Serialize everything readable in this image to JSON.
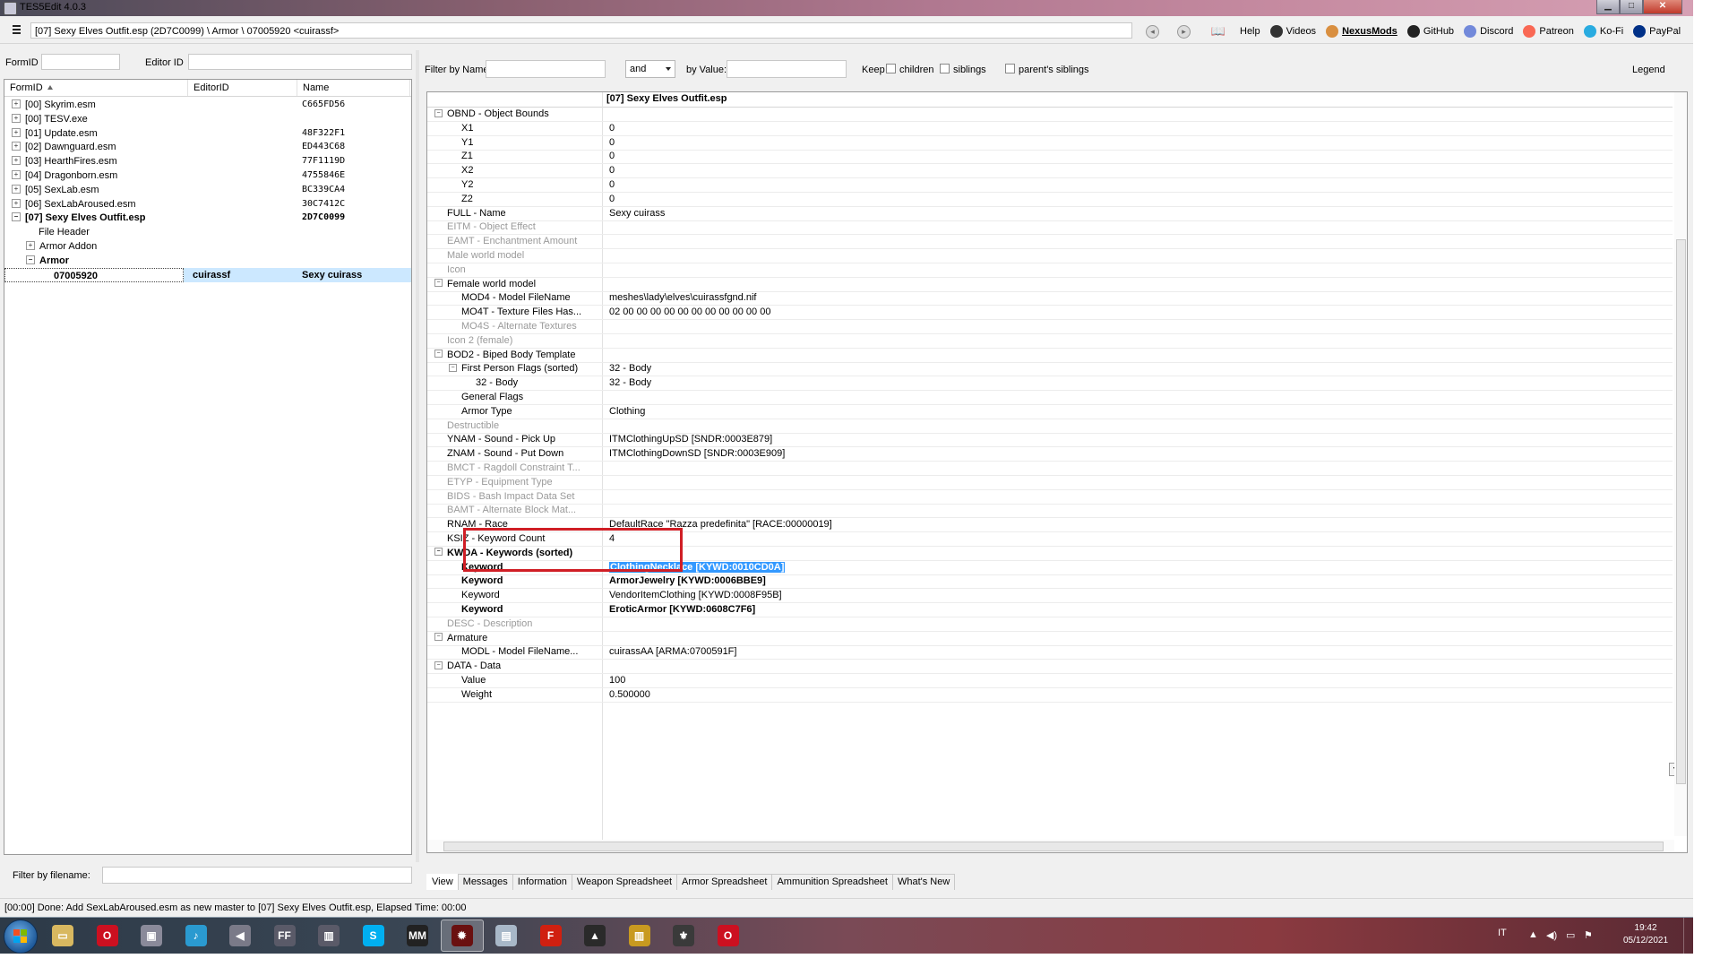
{
  "window": {
    "title": "TES5Edit 4.0.3"
  },
  "toolbar": {
    "path": "[07] Sexy Elves Outfit.esp (2D7C0099) \\ Armor \\ 07005920 <cuirassf>",
    "links": [
      {
        "label": "Help",
        "icon": "book-icon",
        "color": "#555555"
      },
      {
        "label": "Videos",
        "icon": "video-icon",
        "color": "#333333"
      },
      {
        "label": "NexusMods",
        "icon": "nexus-icon",
        "color": "#d98f40"
      },
      {
        "label": "GitHub",
        "icon": "github-icon",
        "color": "#222222"
      },
      {
        "label": "Discord",
        "icon": "discord-icon",
        "color": "#7289da"
      },
      {
        "label": "Patreon",
        "icon": "patreon-icon",
        "color": "#f96854"
      },
      {
        "label": "Ko-Fi",
        "icon": "kofi-icon",
        "color": "#29abe0"
      },
      {
        "label": "PayPal",
        "icon": "paypal-icon",
        "color": "#003087"
      }
    ]
  },
  "left": {
    "formid_label": "FormID",
    "editorid_label": "Editor ID",
    "columns": [
      "FormID",
      "EditorID",
      "Name"
    ],
    "rows": [
      {
        "text": "[00] Skyrim.esm",
        "editor": "",
        "name": "C665FD56",
        "indent": 0,
        "exp": "+",
        "bold": false
      },
      {
        "text": "[00] TESV.exe",
        "editor": "",
        "name": "",
        "indent": 0,
        "exp": "+",
        "bold": false
      },
      {
        "text": "[01] Update.esm",
        "editor": "",
        "name": "48F322F1",
        "indent": 0,
        "exp": "+",
        "bold": false
      },
      {
        "text": "[02] Dawnguard.esm",
        "editor": "",
        "name": "ED443C68",
        "indent": 0,
        "exp": "+",
        "bold": false
      },
      {
        "text": "[03] HearthFires.esm",
        "editor": "",
        "name": "77F1119D",
        "indent": 0,
        "exp": "+",
        "bold": false
      },
      {
        "text": "[04] Dragonborn.esm",
        "editor": "",
        "name": "4755846E",
        "indent": 0,
        "exp": "+",
        "bold": false
      },
      {
        "text": "[05] SexLab.esm",
        "editor": "",
        "name": "BC339CA4",
        "indent": 0,
        "exp": "+",
        "bold": false
      },
      {
        "text": "[06] SexLabAroused.esm",
        "editor": "",
        "name": "30C7412C",
        "indent": 0,
        "exp": "+",
        "bold": false
      },
      {
        "text": "[07] Sexy Elves Outfit.esp",
        "editor": "",
        "name": "2D7C0099",
        "indent": 0,
        "exp": "−",
        "bold": true
      },
      {
        "text": "File Header",
        "editor": "",
        "name": "",
        "indent": 1,
        "exp": "",
        "bold": false
      },
      {
        "text": "Armor Addon",
        "editor": "",
        "name": "",
        "indent": 1,
        "exp": "+",
        "bold": false
      },
      {
        "text": "Armor",
        "editor": "",
        "name": "",
        "indent": 1,
        "exp": "−",
        "bold": true
      },
      {
        "text": "07005920",
        "editor": "cuirassf",
        "name": "Sexy cuirass",
        "indent": 2,
        "exp": "",
        "bold": true,
        "selected": true
      }
    ],
    "filter_label": "Filter by filename:"
  },
  "right": {
    "filter": {
      "by_name": "Filter by Name:",
      "op": "and",
      "by_value": "by Value:",
      "keep": "Keep",
      "children": "children",
      "siblings": "siblings",
      "parents": "parent's siblings",
      "legend": "Legend"
    },
    "header": "[07] Sexy Elves Outfit.esp",
    "rows": [
      {
        "l": "OBND - Object Bounds",
        "v": "",
        "lvl": 0,
        "exp": "−",
        "grey": false
      },
      {
        "l": "X1",
        "v": "0",
        "lvl": 1,
        "exp": "",
        "grey": false
      },
      {
        "l": "Y1",
        "v": "0",
        "lvl": 1,
        "exp": "",
        "grey": false
      },
      {
        "l": "Z1",
        "v": "0",
        "lvl": 1,
        "exp": "",
        "grey": false
      },
      {
        "l": "X2",
        "v": "0",
        "lvl": 1,
        "exp": "",
        "grey": false
      },
      {
        "l": "Y2",
        "v": "0",
        "lvl": 1,
        "exp": "",
        "grey": false
      },
      {
        "l": "Z2",
        "v": "0",
        "lvl": 1,
        "exp": "",
        "grey": false
      },
      {
        "l": "FULL - Name",
        "v": "Sexy cuirass",
        "lvl": 0,
        "exp": "",
        "grey": false
      },
      {
        "l": "EITM - Object Effect",
        "v": "",
        "lvl": 0,
        "exp": "",
        "grey": true
      },
      {
        "l": "EAMT - Enchantment Amount",
        "v": "",
        "lvl": 0,
        "exp": "",
        "grey": true
      },
      {
        "l": "Male world model",
        "v": "",
        "lvl": 0,
        "exp": "",
        "grey": true
      },
      {
        "l": "Icon",
        "v": "",
        "lvl": 0,
        "exp": "",
        "grey": true
      },
      {
        "l": "Female world model",
        "v": "",
        "lvl": 0,
        "exp": "−",
        "grey": false
      },
      {
        "l": "MOD4 - Model FileName",
        "v": "meshes\\lady\\elves\\cuirassfgnd.nif",
        "lvl": 1,
        "exp": "",
        "grey": false
      },
      {
        "l": "MO4T - Texture Files Has...",
        "v": "02 00 00 00 00 00 00 00 00 00 00 00",
        "lvl": 1,
        "exp": "",
        "grey": false
      },
      {
        "l": "MO4S - Alternate Textures",
        "v": "",
        "lvl": 1,
        "exp": "",
        "grey": true
      },
      {
        "l": "Icon 2 (female)",
        "v": "",
        "lvl": 0,
        "exp": "",
        "grey": true
      },
      {
        "l": "BOD2 - Biped Body Template",
        "v": "",
        "lvl": 0,
        "exp": "−",
        "grey": false
      },
      {
        "l": "First Person Flags (sorted)",
        "v": "32 - Body",
        "lvl": 1,
        "exp": "−",
        "grey": false
      },
      {
        "l": "32 - Body",
        "v": "32 - Body",
        "lvl": 2,
        "exp": "",
        "grey": false
      },
      {
        "l": "General Flags",
        "v": "",
        "lvl": 1,
        "exp": "",
        "grey": false
      },
      {
        "l": "Armor Type",
        "v": "Clothing",
        "lvl": 1,
        "exp": "",
        "grey": false
      },
      {
        "l": "Destructible",
        "v": "",
        "lvl": 0,
        "exp": "",
        "grey": true
      },
      {
        "l": "YNAM - Sound - Pick Up",
        "v": "ITMClothingUpSD [SNDR:0003E879]",
        "lvl": 0,
        "exp": "",
        "grey": false
      },
      {
        "l": "ZNAM - Sound - Put Down",
        "v": "ITMClothingDownSD [SNDR:0003E909]",
        "lvl": 0,
        "exp": "",
        "grey": false
      },
      {
        "l": "BMCT - Ragdoll Constraint T...",
        "v": "",
        "lvl": 0,
        "exp": "",
        "grey": true
      },
      {
        "l": "ETYP - Equipment Type",
        "v": "",
        "lvl": 0,
        "exp": "",
        "grey": true
      },
      {
        "l": "BIDS - Bash Impact Data Set",
        "v": "",
        "lvl": 0,
        "exp": "",
        "grey": true
      },
      {
        "l": "BAMT - Alternate Block Mat...",
        "v": "",
        "lvl": 0,
        "exp": "",
        "grey": true
      },
      {
        "l": "RNAM - Race",
        "v": "DefaultRace \"Razza predefinita\" [RACE:00000019]",
        "lvl": 0,
        "exp": "",
        "grey": false
      },
      {
        "l": "KSIZ - Keyword Count",
        "v": "4",
        "lvl": 0,
        "exp": "",
        "grey": false
      },
      {
        "l": "KWDA - Keywords (sorted)",
        "v": "",
        "lvl": 0,
        "exp": "−",
        "grey": false,
        "bold": true
      },
      {
        "l": "Keyword",
        "v": "ClothingNecklace [KYWD:0010CD0A]",
        "lvl": 1,
        "exp": "",
        "grey": false,
        "bold": true,
        "hl": true
      },
      {
        "l": "Keyword",
        "v": "ArmorJewelry [KYWD:0006BBE9]",
        "lvl": 1,
        "exp": "",
        "grey": false,
        "bold": true
      },
      {
        "l": "Keyword",
        "v": "VendorItemClothing [KYWD:0008F95B]",
        "lvl": 1,
        "exp": "",
        "grey": false
      },
      {
        "l": "Keyword",
        "v": "EroticArmor [KYWD:0608C7F6]",
        "lvl": 1,
        "exp": "",
        "grey": false,
        "bold": true
      },
      {
        "l": "DESC - Description",
        "v": "",
        "lvl": 0,
        "exp": "",
        "grey": true
      },
      {
        "l": "Armature",
        "v": "",
        "lvl": 0,
        "exp": "−",
        "grey": false
      },
      {
        "l": "MODL - Model FileName...",
        "v": "cuirassAA [ARMA:0700591F]",
        "lvl": 1,
        "exp": "",
        "grey": false
      },
      {
        "l": "DATA - Data",
        "v": "",
        "lvl": 0,
        "exp": "−",
        "grey": false
      },
      {
        "l": "Value",
        "v": "100",
        "lvl": 1,
        "exp": "",
        "grey": false
      },
      {
        "l": "Weight",
        "v": "0.500000",
        "lvl": 1,
        "exp": "",
        "grey": false
      }
    ]
  },
  "tabs": [
    "View",
    "Messages",
    "Information",
    "Weapon Spreadsheet",
    "Armor Spreadsheet",
    "Ammunition Spreadsheet",
    "What's New"
  ],
  "status": "[00:00] Done: Add SexLabAroused.esm as new master to [07] Sexy Elves Outfit.esp, Elapsed Time: 00:00",
  "taskbar": {
    "apps": [
      {
        "name": "explorer-icon",
        "glyph": "▭",
        "bg": "#d8b860"
      },
      {
        "name": "opera-icon",
        "glyph": "O",
        "bg": "#cc1020"
      },
      {
        "name": "media-icon",
        "glyph": "▣",
        "bg": "#8a8a9a"
      },
      {
        "name": "music-icon",
        "glyph": "♪",
        "bg": "#2a9ad0"
      },
      {
        "name": "volume-app-icon",
        "glyph": "◀",
        "bg": "#7a7a88"
      },
      {
        "name": "ffdec-icon",
        "glyph": "FF",
        "bg": "#5a5a68"
      },
      {
        "name": "app-icon",
        "glyph": "▥",
        "bg": "#5a5a68"
      },
      {
        "name": "skype-icon",
        "glyph": "S",
        "bg": "#00aff0"
      },
      {
        "name": "mm-icon",
        "glyph": "MM",
        "bg": "#222222"
      },
      {
        "name": "xedit-icon",
        "glyph": "✹",
        "bg": "#6a1010"
      },
      {
        "name": "notepad-icon",
        "glyph": "▤",
        "bg": "#a8b8c8"
      },
      {
        "name": "foxit-icon",
        "glyph": "F",
        "bg": "#d02010"
      },
      {
        "name": "ff-icon",
        "glyph": "▲",
        "bg": "#2a2a2a"
      },
      {
        "name": "chart-app-icon",
        "glyph": "▥",
        "bg": "#c89a20"
      },
      {
        "name": "skyrim-icon",
        "glyph": "⚜",
        "bg": "#3a3a3a"
      },
      {
        "name": "opera2-icon",
        "glyph": "O",
        "bg": "#cc1020"
      }
    ],
    "lang": "IT",
    "time": "19:42",
    "date": "05/12/2021"
  }
}
